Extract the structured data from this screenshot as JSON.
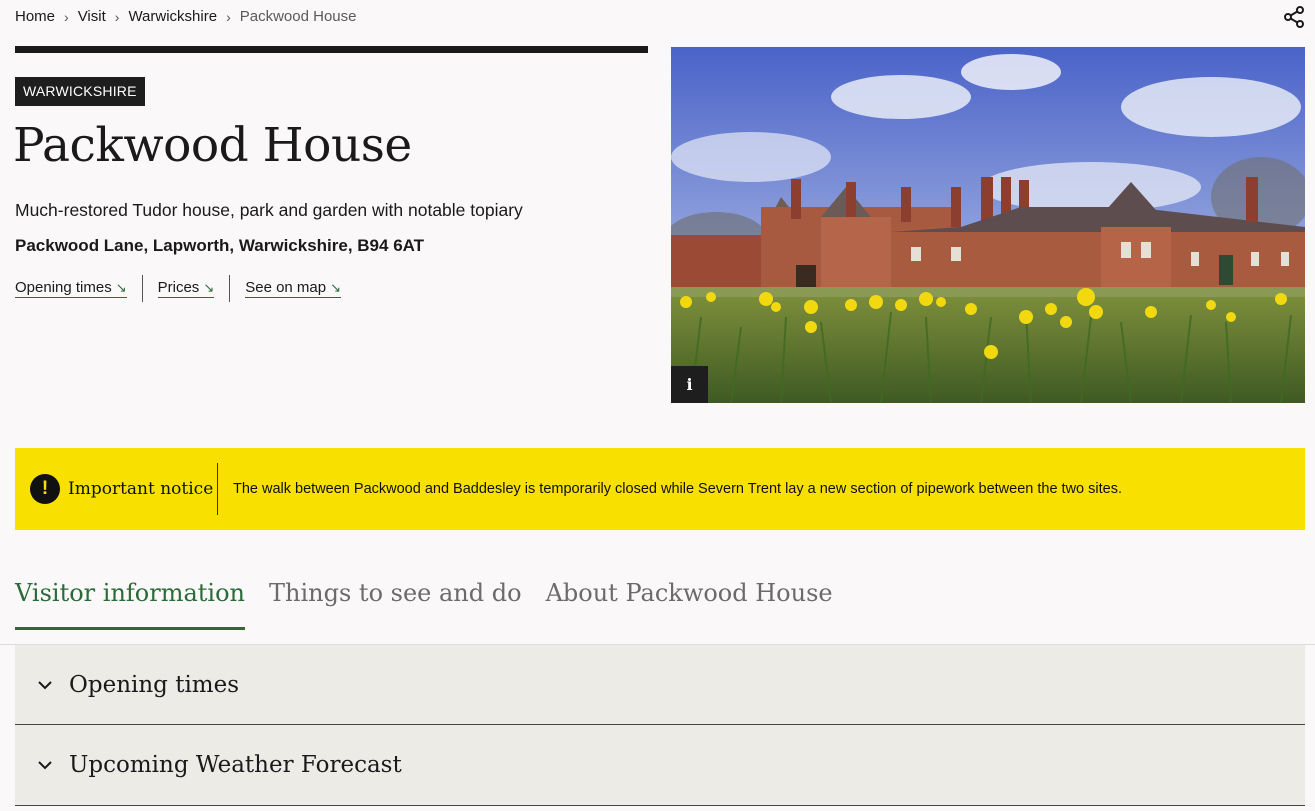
{
  "breadcrumb": {
    "items": [
      "Home",
      "Visit",
      "Warwickshire"
    ],
    "current": "Packwood House",
    "separator": "›"
  },
  "header": {
    "tag": "WARWICKSHIRE",
    "title": "Packwood House",
    "description": "Much-restored Tudor house, park and garden with notable topiary",
    "address": "Packwood Lane, Lapworth, Warwickshire, B94 6AT",
    "links": [
      {
        "label": "Opening times",
        "icon": "arrow-down-right-icon"
      },
      {
        "label": "Prices",
        "icon": "arrow-down-right-icon"
      },
      {
        "label": "See on map",
        "icon": "arrow-down-right-icon"
      }
    ]
  },
  "hero": {
    "info_label": "i",
    "alt": "Packwood House with daffodils in the foreground"
  },
  "notice": {
    "icon_glyph": "!",
    "title": "Important notice",
    "text": "The walk between Packwood and Baddesley is temporarily closed while Severn Trent lay a new section of pipework between the two sites."
  },
  "tabs": [
    {
      "label": "Visitor information",
      "active": true
    },
    {
      "label": "Things to see and do",
      "active": false
    },
    {
      "label": "About Packwood House",
      "active": false
    }
  ],
  "accordion": [
    {
      "label": "Opening times",
      "expanded": false
    },
    {
      "label": "Upcoming Weather Forecast",
      "expanded": false
    }
  ],
  "colors": {
    "accent_green": "#2b6b3a",
    "notice_yellow": "#f8e100",
    "dark": "#1e1e1e",
    "accordion_bg": "#edebe6"
  }
}
